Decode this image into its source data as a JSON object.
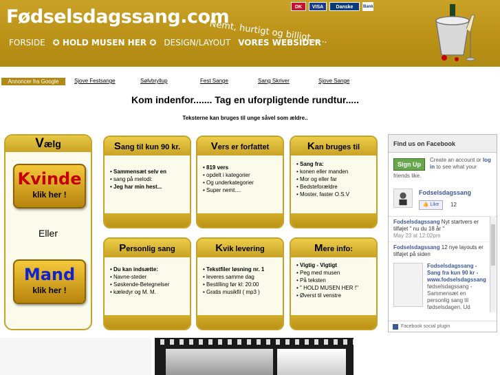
{
  "header": {
    "logo": "Fødselsdagssang.com",
    "slogan": "- Nemt, hurtigt og billigt......",
    "nav": [
      "FORSIDE",
      "✪ HOLD MUSEN HER ✪",
      "DESIGN/LAYOUT",
      "VORES WEBSIDER"
    ],
    "cards": [
      "DK",
      "VISA",
      "Danske",
      "Bank"
    ]
  },
  "ads": {
    "label": "Annoncer fra Google",
    "links": [
      "Sjove Festsange",
      "Sølvbryllup",
      "Fest Sange",
      "Sang Skriver",
      "Sjove Sange"
    ]
  },
  "welcome": "Kom indenfor....... Tag en uforpligtende rundtur.....",
  "subtitle": "Teksterne kan bruges til unge såvel som ældre..",
  "choose": {
    "caption_first": "V",
    "caption_rest": "ælg",
    "kvinde": "Kvinde",
    "mand": "Mand",
    "klik": "klik her !",
    "eller": "Eller"
  },
  "boxes": [
    {
      "first": "S",
      "rest": "ang til kun 90 kr.",
      "items": [
        "Sammensæt selv en",
        "sang på melodi:",
        "Jeg har min hest..."
      ]
    },
    {
      "first": "V",
      "rest": "ers er forfattet",
      "items": [
        "819 vers",
        "opdelt i kategorier",
        "Og underkategorier",
        "Super nemt...."
      ]
    },
    {
      "first": "K",
      "rest": "an bruges til",
      "items": [
        "Sang fra:",
        "konen eller manden",
        "Mor og eller far",
        "Bedsteforældre",
        "Moster, faster O.S.V"
      ]
    },
    {
      "first": "P",
      "rest": "ersonlig sang",
      "items": [
        "Du kan indsætte:",
        "Navne-steder",
        "Søskende-Betegnelser",
        "kæledyr og M. M."
      ]
    },
    {
      "first": "K",
      "rest": "vik levering",
      "items": [
        "Tekstfiler løsning nr. 1",
        "leveres samme dag",
        "Bestilling før kl: 20:00",
        "Gratis musikfil ( mp3 )"
      ]
    },
    {
      "first": "M",
      "rest": "ere info:",
      "items": [
        "Vigtig - Vigtigt",
        "Peg med musen",
        "På teksten",
        "\" HOLD MUSEN HER !\"",
        "Øverst til venstre"
      ]
    }
  ],
  "facebook": {
    "title": "Find us on Facebook",
    "signup": "Sign Up",
    "text_a": "Create an account or ",
    "log_in": "log in",
    "text_b": " to see what your",
    "text_c": "friends like.",
    "page_name": "Fodselsdagssang",
    "like": "Like",
    "likes": "12",
    "post1_who": "Fodselsdagssang",
    "post1_text": " Nyt startvers er tilføjet \" nu du 18 år \"",
    "post1_date": "May 23 at 12:02pm",
    "post2_who": "Fodselsdagssang",
    "post2_text": " 12 nye layouts er tilføjet på siden",
    "post2_link": "Fodselsdagssang - Sang fra kun 90 kr - www.fodselsdagssang",
    "post2_desc": "fødselsdagssang - Sammensæt en personlig sang til fødselsdagen. Ud",
    "footer": "Facebook social plugin"
  }
}
